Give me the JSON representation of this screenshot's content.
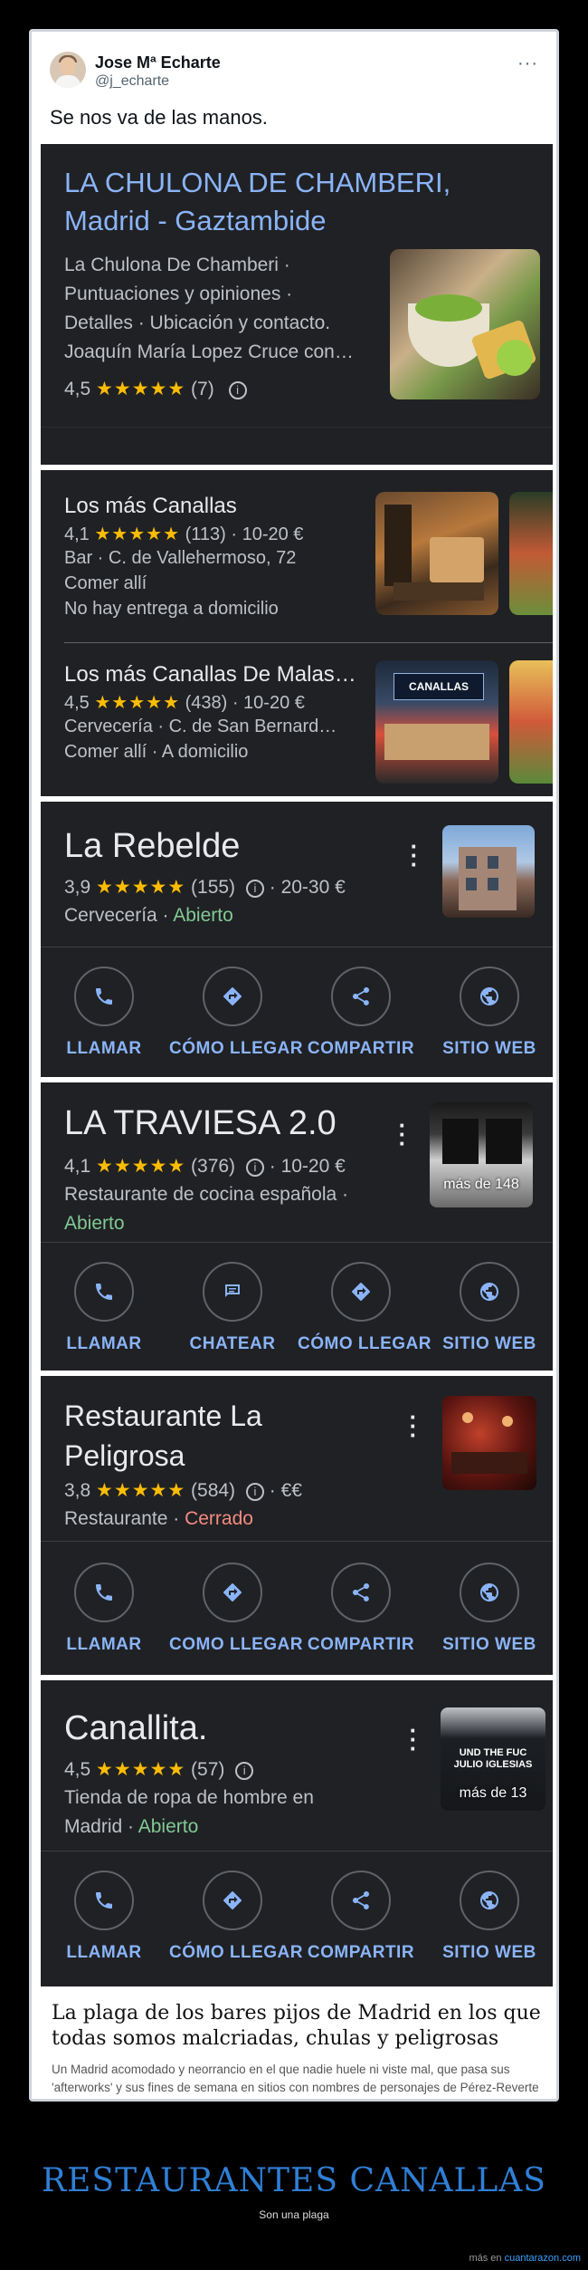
{
  "tweet": {
    "name": "Jose Mª Echarte",
    "handle": "@j_echarte",
    "more": "···",
    "text": "Se nos va de las manos."
  },
  "result1": {
    "title": "LA CHULONA DE CHAMBERI, Madrid - Gaztambide",
    "lines": [
      "La Chulona De Chamberi ·",
      "Puntuaciones y opiniones ·",
      "Detalles · Ubicación y contacto.",
      "Joaquín María Lopez Cruce con…"
    ],
    "rating": "4,5",
    "stars": "★★★★★",
    "count": "(7)"
  },
  "list": [
    {
      "title": "Los más Canallas",
      "rating": "4,1",
      "stars": "★★★★★",
      "meta": "(113) · 10-20 €",
      "line2": "Bar · C. de Vallehermoso, 72",
      "line3": "Comer allí",
      "line4": "No hay entrega a domicilio"
    },
    {
      "title": "Los más Canallas De Malas…",
      "rating": "4,5",
      "stars": "★★★★★",
      "meta": "(438) · 10-20 €",
      "line2": "Cervecería · C. de San Bernard…",
      "line3": "Comer allí · A domicilio",
      "sign": "CANALLAS"
    }
  ],
  "businesses": [
    {
      "name": "La Rebelde",
      "rating": "3,9",
      "stars": "★★★★★",
      "count": "(155)",
      "price": "· 20-30 €",
      "category": "Cervecería ·",
      "status": "Abierto",
      "actions": [
        "LLAMAR",
        "CÓMO LLEGAR",
        "COMPARTIR",
        "SITIO WEB"
      ]
    },
    {
      "name": "LA TRAVIESA 2.0",
      "rating": "4,1",
      "stars": "★★★★★",
      "count": "(376)",
      "price": "· 10-20 €",
      "category": "Restaurante de cocina española ·",
      "status": "Abierto",
      "photo_count": "más de 148",
      "actions": [
        "LLAMAR",
        "CHATEAR",
        "CÓMO LLEGAR",
        "SITIO WEB"
      ]
    },
    {
      "name": "Restaurante La Peligrosa",
      "name_l1": "Restaurante La",
      "name_l2": "Peligrosa",
      "rating": "3,8",
      "stars": "★★★★★",
      "count": "(584)",
      "price": "· €€",
      "category": "Restaurante ·",
      "status": "Cerrado",
      "actions": [
        "LLAMAR",
        "COMO LLEGAR",
        "COMPARTIR",
        "SITIO WEB"
      ]
    },
    {
      "name": "Canallita.",
      "rating": "4,5",
      "stars": "★★★★★",
      "count": "(57)",
      "category": "Tienda de ropa de hombre en",
      "category2": "Madrid ·",
      "status": "Abierto",
      "photo_count": "más de 13",
      "shirt_text": "UND THE FUC JULIO IGLESIAS",
      "actions": [
        "LLAMAR",
        "CÓMO LLEGAR",
        "COMPARTIR",
        "SITIO WEB"
      ]
    }
  ],
  "caption": {
    "title": "La plaga de los bares pijos de Madrid en los que todas somos malcriadas, chulas y peligrosas",
    "desc": "Un Madrid acomodado y neorrancio en el que nadie huele ni viste mal, que pasa sus 'afterworks' y sus fines de semana en sitios con nombres de personajes de Pérez-Reverte"
  },
  "page": {
    "title": "RESTAURANTES CANALLAS",
    "subtitle": "Son una plaga",
    "footer_prefix": "más en",
    "footer_link": "cuantarazon.com"
  },
  "icons": {
    "info": "info-icon",
    "phone": "phone-icon",
    "directions": "directions-icon",
    "share": "share-icon",
    "web": "globe-icon",
    "chat": "chat-icon",
    "more": "more-vert-icon"
  },
  "colors": {
    "link_blue": "#8ab4f8",
    "star": "#fbbc04",
    "open": "#81c995",
    "closed": "#f28b82",
    "panel": "#202124",
    "title_blue": "#2f7fd6"
  }
}
